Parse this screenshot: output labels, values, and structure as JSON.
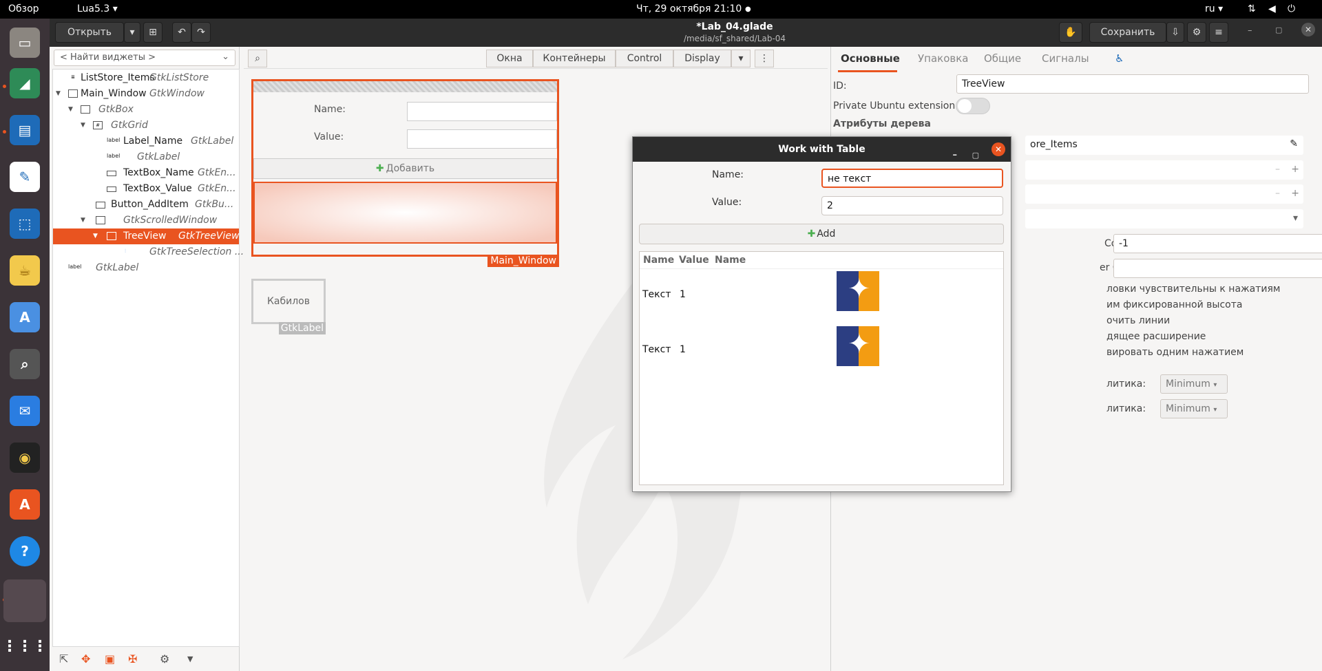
{
  "topbar": {
    "overview": "Обзор",
    "app_menu": "Lua5.3 ▾",
    "datetime": "Чт, 29 октября  21:10",
    "lang": "ru ▾"
  },
  "header": {
    "open_label": "Открыть",
    "title": "*Lab_04.glade",
    "subtitle": "/media/sf_shared/Lab-04",
    "save_label": "Сохранить"
  },
  "left_panel": {
    "search_placeholder": "< Найти виджеты >",
    "tree": [
      {
        "name": "ListStore_Items",
        "type": "GtkListStore"
      },
      {
        "name": "Main_Window",
        "type": "GtkWindow"
      },
      {
        "name": "",
        "type": "GtkBox"
      },
      {
        "name": "",
        "type": "GtkGrid"
      },
      {
        "name": "Label_Name",
        "type": "GtkLabel"
      },
      {
        "name": "",
        "type": "GtkLabel"
      },
      {
        "name": "TextBox_Name",
        "type": "GtkEn..."
      },
      {
        "name": "TextBox_Value",
        "type": "GtkEn..."
      },
      {
        "name": "Button_AddItem",
        "type": "GtkBu..."
      },
      {
        "name": "",
        "type": "GtkScrolledWindow"
      },
      {
        "name": "TreeView",
        "type": "GtkTreeView"
      },
      {
        "name": "",
        "type": "GtkTreeSelection ..."
      },
      {
        "name": "",
        "type": "GtkLabel"
      }
    ]
  },
  "canvas": {
    "tabs": [
      "Окна",
      "Контейнеры",
      "Control",
      "Display"
    ],
    "main_window": {
      "name_label": "Name:",
      "value_label": "Value:",
      "add_button": "Добавить",
      "tag": "Main_Window"
    },
    "label_widget": {
      "text": "Кабилов",
      "tag": "GtkLabel"
    }
  },
  "props": {
    "tabs": [
      "Основные",
      "Упаковка",
      "Общие",
      "Сигналы"
    ],
    "id_label": "ID:",
    "id_value": "TreeView",
    "ext_label": "Private Ubuntu extension:",
    "section": "Атрибуты дерева",
    "model_value": "ore_Items",
    "column_label": "Column:",
    "column_value": "-1",
    "er_column_label": "er Column:",
    "checks": [
      "ловки чувствительны к нажатиям",
      "им фиксированной высота",
      "очить линии",
      "дящее расширение",
      "вировать одним нажатием"
    ],
    "policy_label": "литика:",
    "policy_value": "Minimum"
  },
  "dialog": {
    "title": "Work with Table",
    "name_label": "Name:",
    "name_value": "не текст",
    "value_label": "Value:",
    "value_value": "2",
    "add_label": "Add",
    "columns": [
      "Name",
      "Value",
      "Name"
    ],
    "rows": [
      {
        "name": "Текст",
        "value": "1"
      },
      {
        "name": "Текст",
        "value": "1"
      }
    ]
  }
}
